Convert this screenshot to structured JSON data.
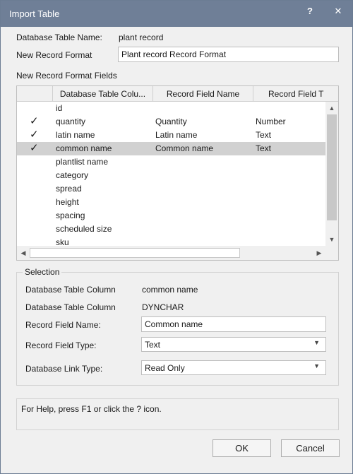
{
  "window": {
    "title": "Import Table",
    "help_icon": "?",
    "close_icon": "✕"
  },
  "form": {
    "db_table_name_label": "Database Table Name:",
    "db_table_name_value": "plant record",
    "new_record_format_label": "New Record Format",
    "new_record_format_value": "Plant record Record Format",
    "fields_section_label": "New Record Format Fields"
  },
  "grid": {
    "columns": [
      "Database Table Colu...",
      "Record Field Name",
      "Record Field T"
    ],
    "rows": [
      {
        "checked": "",
        "db_column": "id",
        "field_name": "",
        "field_type": ""
      },
      {
        "checked": "✓",
        "db_column": "quantity",
        "field_name": "Quantity",
        "field_type": "Number"
      },
      {
        "checked": "✓",
        "db_column": "latin name",
        "field_name": "Latin name",
        "field_type": "Text"
      },
      {
        "checked": "✓",
        "db_column": "common name",
        "field_name": "Common name",
        "field_type": "Text"
      },
      {
        "checked": "",
        "db_column": "plantlist name",
        "field_name": "",
        "field_type": ""
      },
      {
        "checked": "",
        "db_column": "category",
        "field_name": "",
        "field_type": ""
      },
      {
        "checked": "",
        "db_column": "spread",
        "field_name": "",
        "field_type": ""
      },
      {
        "checked": "",
        "db_column": "height",
        "field_name": "",
        "field_type": ""
      },
      {
        "checked": "",
        "db_column": "spacing",
        "field_name": "",
        "field_type": ""
      },
      {
        "checked": "",
        "db_column": "scheduled size",
        "field_name": "",
        "field_type": ""
      },
      {
        "checked": "",
        "db_column": "sku",
        "field_name": "",
        "field_type": ""
      }
    ],
    "selected_row": "common name"
  },
  "selection": {
    "title": "Selection",
    "db_column_label": "Database Table Column",
    "db_column_value": "common name",
    "db_column_type_label": "Database Table Column",
    "db_column_type_value": "DYNCHAR",
    "record_field_name_label": "Record Field Name:",
    "record_field_name_value": "Common name",
    "record_field_type_label": "Record Field Type:",
    "record_field_type_value": "Text",
    "db_link_type_label": "Database Link Type:",
    "db_link_type_value": "Read Only"
  },
  "help": {
    "text": "For Help, press F1 or click the ? icon."
  },
  "buttons": {
    "ok": "OK",
    "cancel": "Cancel"
  }
}
